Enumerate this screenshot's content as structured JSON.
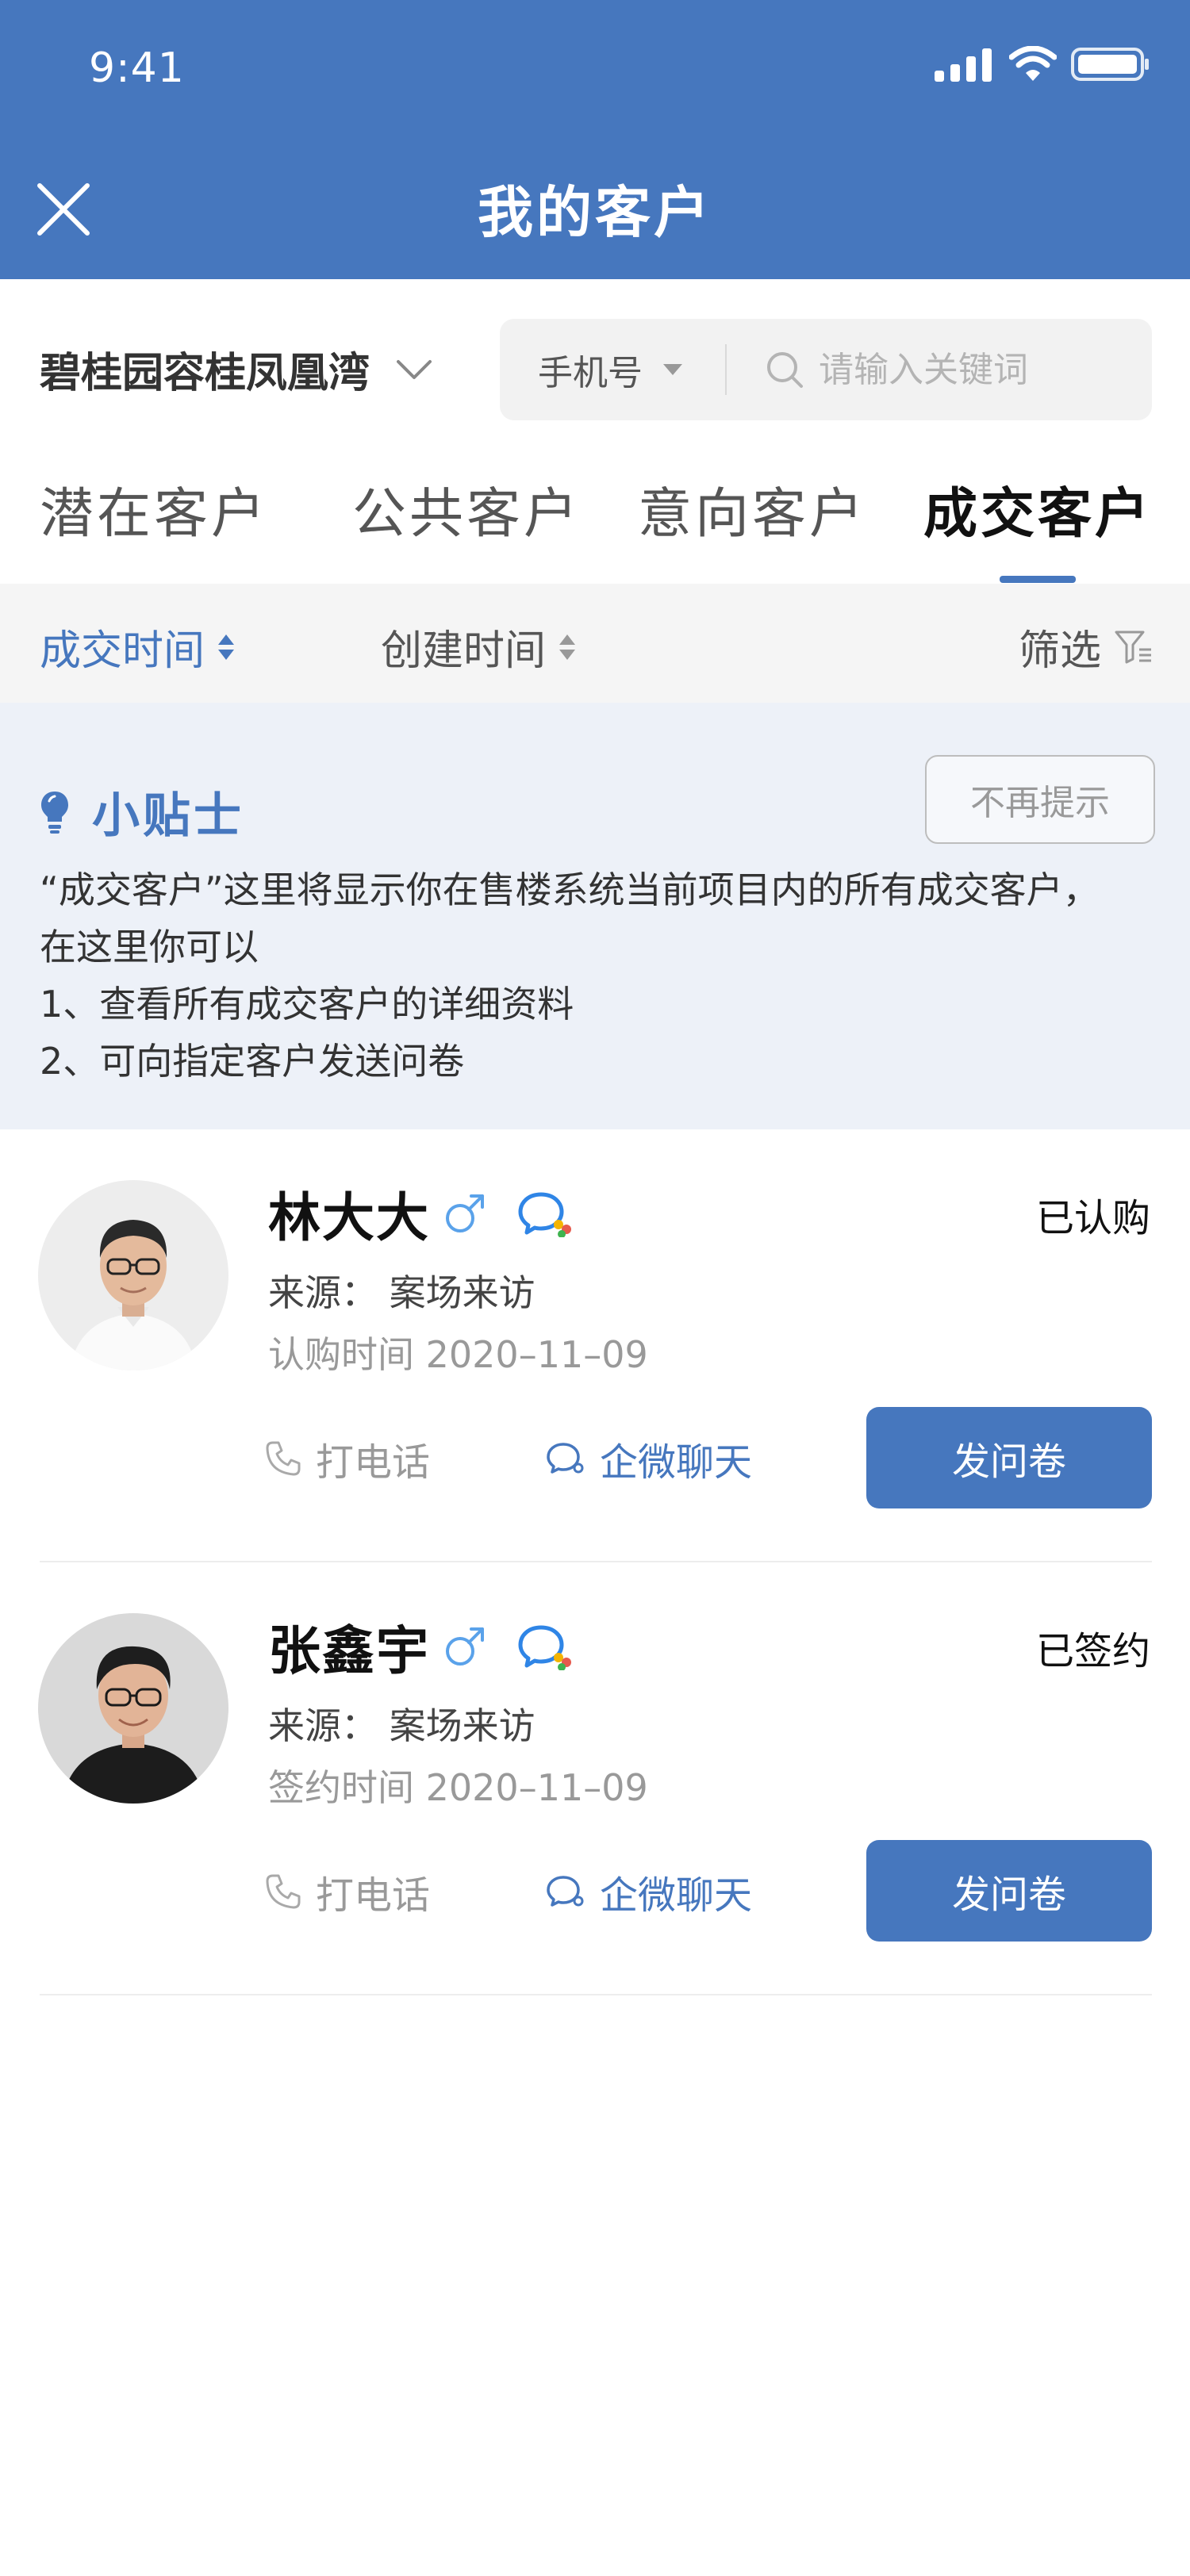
{
  "status_bar": {
    "time": "9:41"
  },
  "header": {
    "title": "我的客户"
  },
  "project": {
    "name": "碧桂园容桂凤凰湾"
  },
  "search": {
    "type_label": "手机号",
    "placeholder": "请输入关键词"
  },
  "tabs": [
    {
      "label": "潜在客户",
      "active": false
    },
    {
      "label": "公共客户",
      "active": false
    },
    {
      "label": "意向客户",
      "active": false
    },
    {
      "label": "成交客户",
      "active": true
    }
  ],
  "sort": {
    "deal_time": "成交时间",
    "create_time": "创建时间",
    "filter": "筛选"
  },
  "tips": {
    "title": "小贴士",
    "dismiss": "不再提示",
    "lines": [
      "“成交客户”这里将显示你在售楼系统当前项目内的所有成交客户，",
      "在这里你可以",
      "1、查看所有成交客户的详细资料",
      "2、可向指定客户发送问卷"
    ]
  },
  "customers": [
    {
      "name": "林大大",
      "gender_symbol": "♂",
      "status": "已认购",
      "source": "来源：  案场来访",
      "date": "认购时间 2020–11–09",
      "call_label": "打电话",
      "chat_label": "企微聊天",
      "survey_label": "发问卷"
    },
    {
      "name": "张鑫宇",
      "gender_symbol": "♂",
      "status": "已签约",
      "source": "来源：  案场来访",
      "date": "签约时间 2020–11–09",
      "call_label": "打电话",
      "chat_label": "企微聊天",
      "survey_label": "发问卷"
    }
  ],
  "colors": {
    "primary": "#4677BE",
    "gender_male": "#5AA2EA",
    "tips_bg": "#EDF1F8"
  },
  "icons": [
    "signal-icon",
    "wifi-icon",
    "battery-icon",
    "close-icon",
    "chevron-down-icon",
    "caret-down-icon",
    "search-icon",
    "sort-icon",
    "filter-icon",
    "bulb-icon",
    "male-icon",
    "wecom-icon",
    "phone-icon",
    "chat-icon"
  ]
}
